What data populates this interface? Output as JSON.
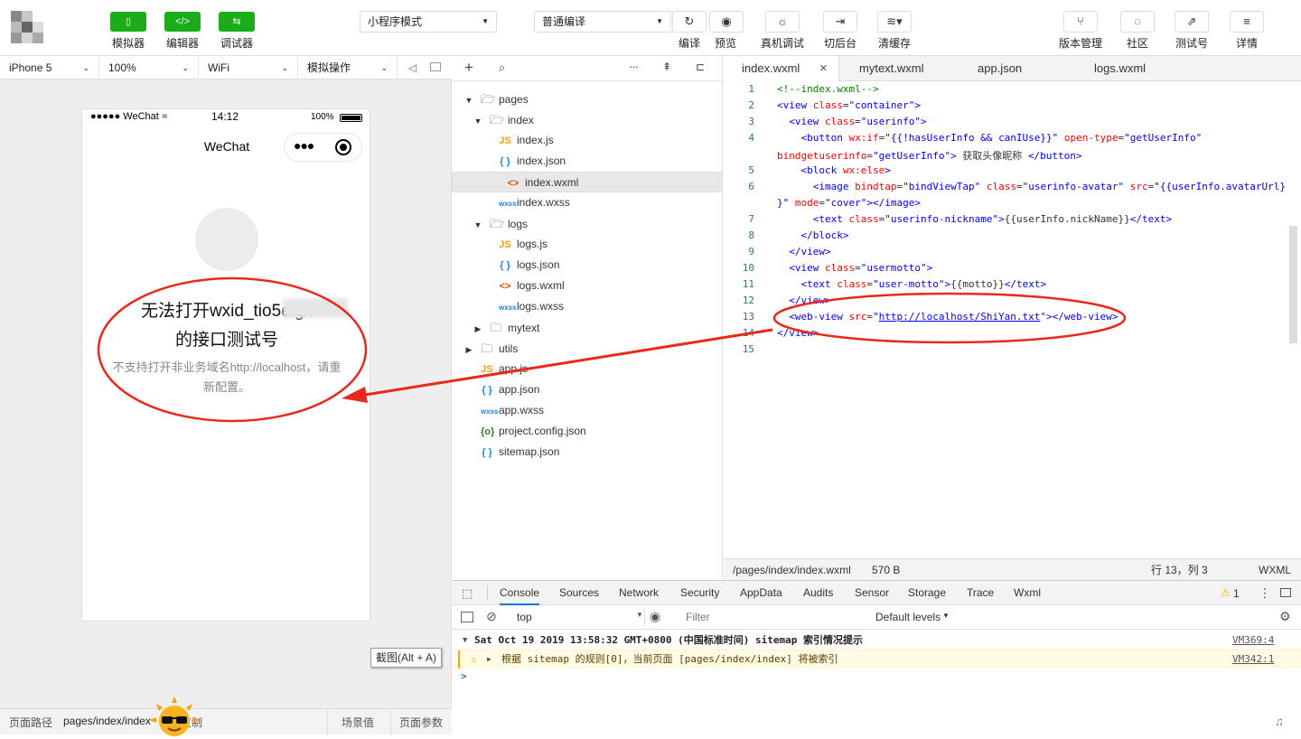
{
  "toolbar": {
    "left_buttons": [
      {
        "icon": "phone-icon",
        "label": "模拟器"
      },
      {
        "icon": "code-icon",
        "label": "编辑器"
      },
      {
        "icon": "debug-icon",
        "label": "调试器"
      }
    ],
    "mode_select": "小程序模式",
    "compile_select": "普通编译",
    "center_buttons": [
      {
        "icon": "refresh-icon",
        "label": "编译"
      },
      {
        "icon": "eye-icon",
        "label": "预览"
      },
      {
        "icon": "bug-icon",
        "label": "真机调试"
      },
      {
        "icon": "background-icon",
        "label": "切后台"
      },
      {
        "icon": "layers-icon",
        "label": "清缓存"
      }
    ],
    "right_buttons": [
      {
        "icon": "branch-icon",
        "label": "版本管理"
      },
      {
        "icon": "chat-icon",
        "label": "社区"
      },
      {
        "icon": "external-link-icon",
        "label": "测试号"
      },
      {
        "icon": "menu-icon",
        "label": "详情"
      }
    ]
  },
  "devbar": {
    "device": "iPhone 5",
    "zoom": "100%",
    "network": "WiFi",
    "operation": "模拟操作"
  },
  "phone": {
    "status_left": "●●●●● WeChat",
    "status_time": "14:12",
    "status_battery": "100%",
    "nav_title": "WeChat",
    "error_title_line1": "无法打开wxid_tio5elgx",
    "error_title_line2": "的接口测试号",
    "error_desc_line1": "不支持打开非业务域名http://localhost，请重",
    "error_desc_line2": "新配置。"
  },
  "screenshot_tooltip": "截图(Alt + A)",
  "bottombar": {
    "path_label": "页面路径",
    "path_value": "pages/index/index",
    "copy_label": "复制",
    "scene_label": "场景值",
    "params_label": "页面参数"
  },
  "tree": [
    {
      "depth": 0,
      "type": "folder",
      "open": true,
      "name": "pages"
    },
    {
      "depth": 1,
      "type": "folder",
      "open": true,
      "name": "index"
    },
    {
      "depth": 2,
      "type": "js",
      "name": "index.js"
    },
    {
      "depth": 2,
      "type": "json",
      "name": "index.json"
    },
    {
      "depth": 2,
      "type": "wxml",
      "name": "index.wxml",
      "selected": true
    },
    {
      "depth": 2,
      "type": "wxss",
      "name": "index.wxss"
    },
    {
      "depth": 1,
      "type": "folder",
      "open": true,
      "name": "logs"
    },
    {
      "depth": 2,
      "type": "js",
      "name": "logs.js"
    },
    {
      "depth": 2,
      "type": "json",
      "name": "logs.json"
    },
    {
      "depth": 2,
      "type": "wxml",
      "name": "logs.wxml"
    },
    {
      "depth": 2,
      "type": "wxss",
      "name": "logs.wxss"
    },
    {
      "depth": 1,
      "type": "folder",
      "open": false,
      "name": "mytext"
    },
    {
      "depth": 0,
      "type": "folder",
      "open": false,
      "name": "utils"
    },
    {
      "depth": 0,
      "type": "js",
      "name": "app.js"
    },
    {
      "depth": 0,
      "type": "json",
      "name": "app.json"
    },
    {
      "depth": 0,
      "type": "wxss",
      "name": "app.wxss"
    },
    {
      "depth": 0,
      "type": "config",
      "name": "project.config.json"
    },
    {
      "depth": 0,
      "type": "json",
      "name": "sitemap.json"
    }
  ],
  "editor": {
    "tabs": [
      "index.wxml",
      "mytext.wxml",
      "app.json",
      "logs.wxml"
    ],
    "close_glyph": "×",
    "line_numbers": [
      "1",
      "2",
      "3",
      "4",
      "",
      "5",
      "6",
      "",
      "7",
      "8",
      "9",
      "10",
      "11",
      "12",
      "13",
      "14",
      "15"
    ],
    "status_path": "/pages/index/index.wxml",
    "status_size": "570 B",
    "status_pos": "行 13，列 3",
    "status_lang": "WXML"
  },
  "console": {
    "tabs": [
      "Console",
      "Sources",
      "Network",
      "Security",
      "AppData",
      "Audits",
      "Sensor",
      "Storage",
      "Trace",
      "Wxml"
    ],
    "warning_count": "1",
    "context": "top",
    "filter_placeholder": "Filter",
    "levels": "Default levels",
    "line1": "Sat Oct 19 2019 13:58:32 GMT+0800 (中国标准时间) sitemap 索引情况提示",
    "line1_src": "VM369:4",
    "line2": "根据 sitemap 的规则[0]，当前页面 [pages/index/index] 将被索引",
    "line2_src": "VM342:1",
    "prompt": ">"
  },
  "colors": {
    "accent_green": "#1aad19",
    "annotation_red": "#e8291c"
  }
}
